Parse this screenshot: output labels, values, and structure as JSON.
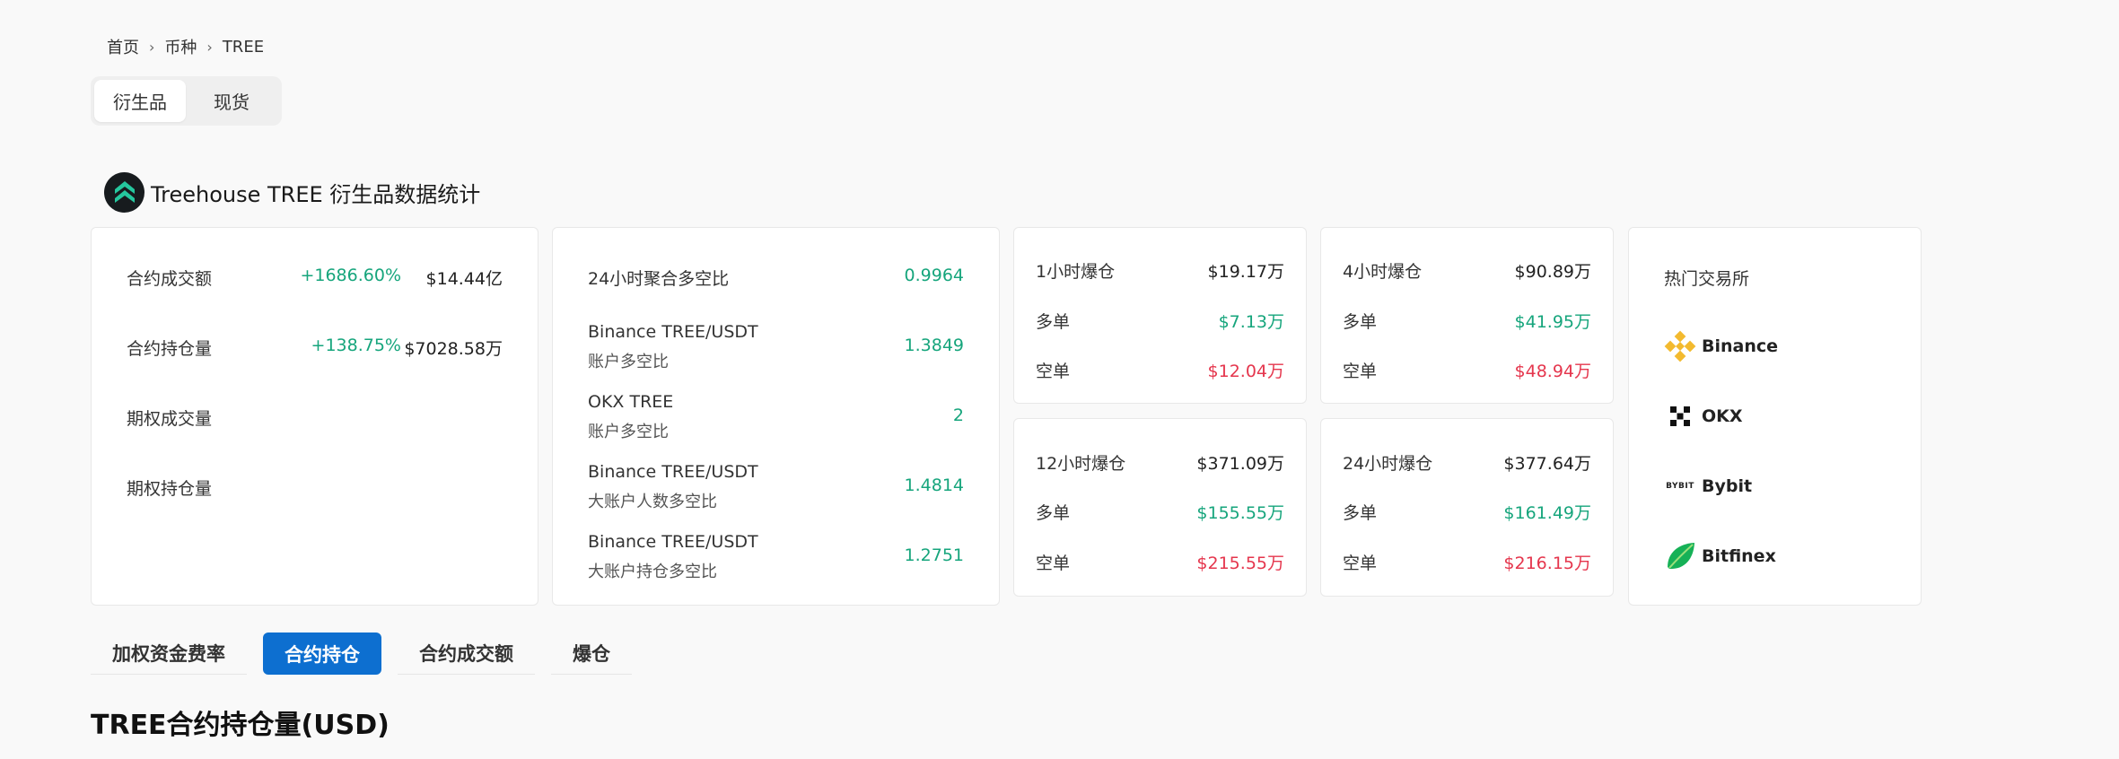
{
  "breadcrumb": {
    "home": "首页",
    "coins": "币种",
    "current": "TREE",
    "separator": "›"
  },
  "market_toggle": {
    "derivatives": "衍生品",
    "spot": "现货",
    "selected": "衍生品"
  },
  "page_title": "Treehouse TREE 衍生品数据统计",
  "overview": [
    {
      "label": "合约成交额",
      "change": "+1686.60%",
      "value": "$14.44亿"
    },
    {
      "label": "合约持仓量",
      "change": "+138.75%",
      "value": "$7028.58万"
    },
    {
      "label": "期权成交量",
      "change": "",
      "value": ""
    },
    {
      "label": "期权持仓量",
      "change": "",
      "value": ""
    }
  ],
  "long_short": [
    {
      "label": "24小时聚合多空比",
      "sub": "",
      "value": "0.9964"
    },
    {
      "label": "Binance TREE/USDT",
      "sub": "账户多空比",
      "value": "1.3849"
    },
    {
      "label": "OKX TREE",
      "sub": "账户多空比",
      "value": "2"
    },
    {
      "label": "Binance TREE/USDT",
      "sub": "大账户人数多空比",
      "value": "1.4814"
    },
    {
      "label": "Binance TREE/USDT",
      "sub": "大账户持仓多空比",
      "value": "1.2751"
    }
  ],
  "liquidations": {
    "long_label": "多单",
    "short_label": "空单",
    "h1": {
      "title": "1小时爆仓",
      "total": "$19.17万",
      "long": "$7.13万",
      "short": "$12.04万"
    },
    "h4": {
      "title": "4小时爆仓",
      "total": "$90.89万",
      "long": "$41.95万",
      "short": "$48.94万"
    },
    "h12": {
      "title": "12小时爆仓",
      "total": "$371.09万",
      "long": "$155.55万",
      "short": "$215.55万"
    },
    "h24": {
      "title": "24小时爆仓",
      "total": "$377.64万",
      "long": "$161.49万",
      "short": "$216.15万"
    }
  },
  "exchanges": {
    "title": "热门交易所",
    "items": [
      {
        "name": "Binance",
        "icon": "binance-icon"
      },
      {
        "name": "OKX",
        "icon": "okx-icon"
      },
      {
        "name": "Bybit",
        "icon": "bybit-icon"
      },
      {
        "name": "Bitfinex",
        "icon": "bitfinex-icon"
      }
    ],
    "bybit_icon_text": "BYBIT"
  },
  "tabs": [
    "加权资金费率",
    "合约持仓",
    "合约成交额",
    "爆仓"
  ],
  "selected_tab": "合约持仓",
  "section_title": "TREE合约持仓量(USD)",
  "colors": {
    "green": "#16a57c",
    "red": "#e5364d",
    "accent": "#0d6fd0",
    "binance": "#f3ba2f",
    "bitfinex": "#16b157"
  }
}
